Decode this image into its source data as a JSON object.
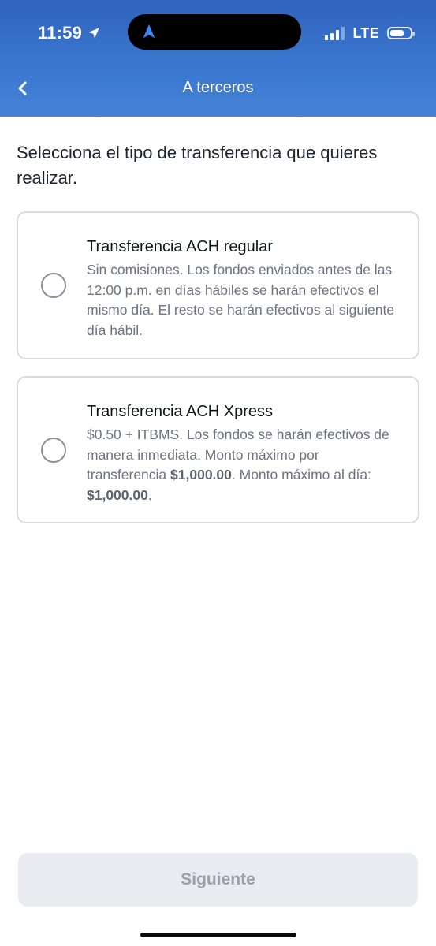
{
  "status_bar": {
    "time": "11:59",
    "network": "LTE",
    "icons": [
      "location-arrow-icon",
      "navigation-arrow-icon",
      "signal-bars-icon",
      "battery-icon"
    ]
  },
  "header": {
    "title": "A terceros",
    "back_icon": "chevron-left-icon"
  },
  "main": {
    "instruction": "Selecciona el tipo de transferencia que quieres realizar.",
    "options": [
      {
        "title": "Transferencia ACH regular",
        "description": "Sin comisiones. Los fondos enviados antes de las 12:00 p.m. en días hábiles se harán efectivos el mismo día. El resto se harán efectivos al siguiente día hábil.",
        "selected": false
      },
      {
        "title": "Transferencia ACH Xpress",
        "description_parts": {
          "part1": "$0.50 + ITBMS. Los fondos se harán efectivos de manera inmediata. Monto máximo por transferencia ",
          "amount1": "$1,000.00",
          "part2": ". Monto máximo al día: ",
          "amount2": "$1,000.00",
          "part3": "."
        },
        "selected": false
      }
    ]
  },
  "footer": {
    "next_label": "Siguiente"
  },
  "colors": {
    "header_gradient_top": "#2f63bd",
    "header_gradient_bottom": "#4583d8",
    "card_border": "#d9dce3",
    "button_disabled_bg": "#ebecf1",
    "button_disabled_text": "#9aa0ab"
  }
}
